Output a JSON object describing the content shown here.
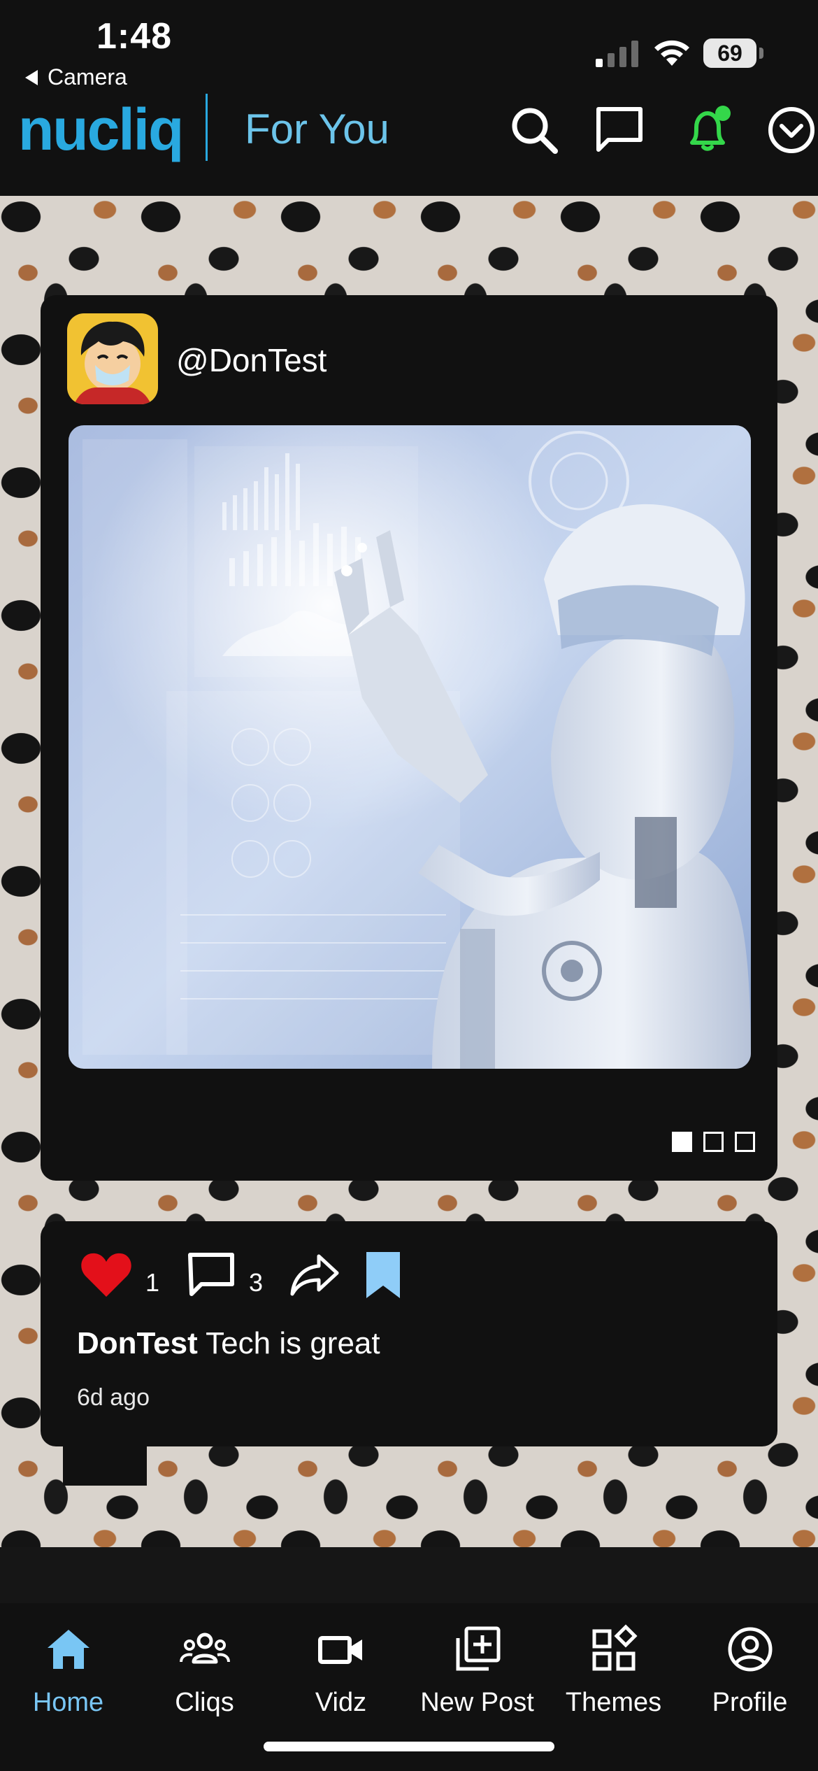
{
  "status_bar": {
    "time": "1:48",
    "back_label": "Camera",
    "battery": "69"
  },
  "header": {
    "logo": "nucliq",
    "title": "For You",
    "accent_color": "#29a9e0",
    "notification_dot_color": "#34d74a",
    "icons": [
      "search-icon",
      "chat-icon",
      "bell-icon",
      "chevron-down-circle-icon"
    ]
  },
  "post": {
    "username": "@DonTest",
    "image_pages": 3,
    "active_page": 1
  },
  "actions": {
    "like_count": "1",
    "comment_count": "3",
    "like_color": "#e3101a",
    "bookmark_color": "#8fcdf8"
  },
  "caption": {
    "author": "DonTest",
    "text": "Tech is great",
    "time_ago": "6d ago"
  },
  "tabs": [
    {
      "label": "Home",
      "icon": "home-icon",
      "active": true
    },
    {
      "label": "Cliqs",
      "icon": "group-icon",
      "active": false
    },
    {
      "label": "Vidz",
      "icon": "video-camera-icon",
      "active": false
    },
    {
      "label": "New Post",
      "icon": "add-box-icon",
      "active": false
    },
    {
      "label": "Themes",
      "icon": "widgets-icon",
      "active": false
    },
    {
      "label": "Profile",
      "icon": "account-circle-icon",
      "active": false
    }
  ],
  "active_tab_color": "#79c6f4"
}
